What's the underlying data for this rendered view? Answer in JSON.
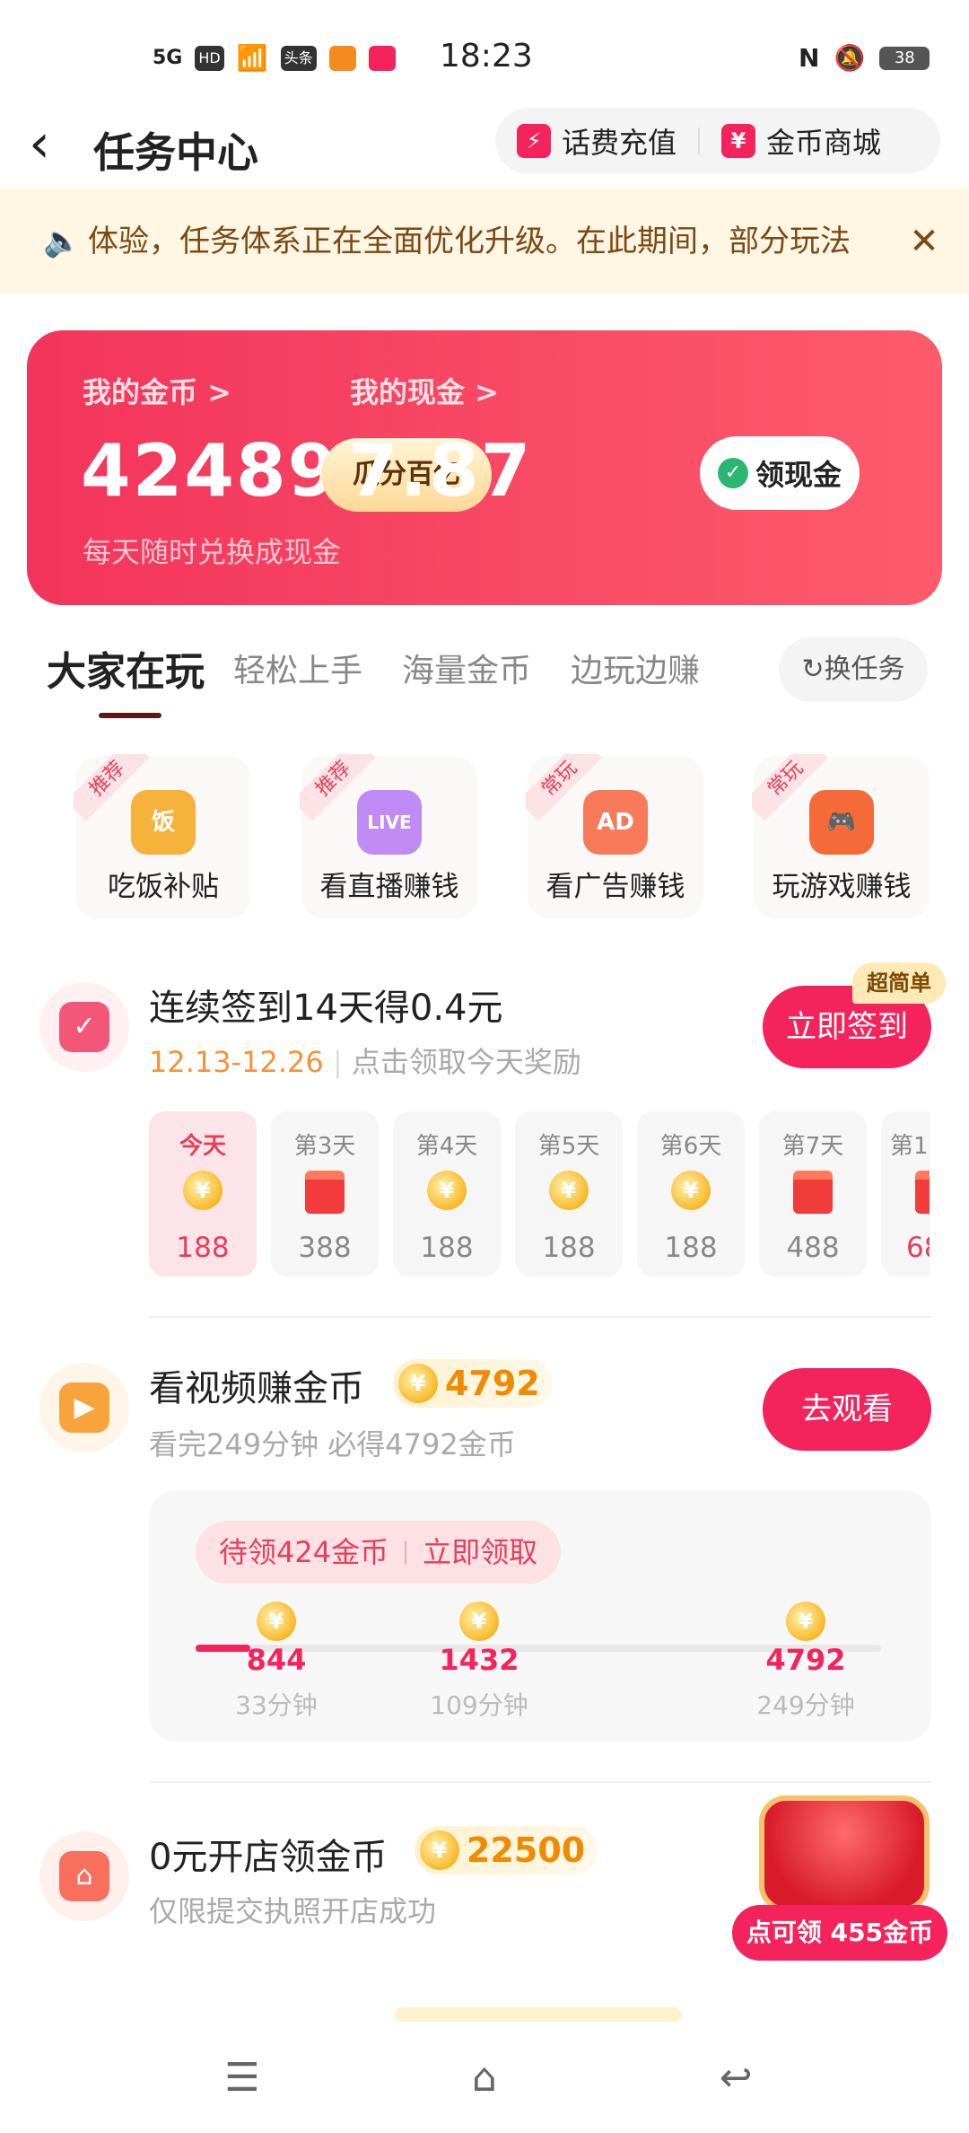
{
  "status": {
    "time": "18:23",
    "battery": "38",
    "network": "5G",
    "hd": "HD",
    "news_label": "头条"
  },
  "header": {
    "title": "任务中心",
    "recharge": "话费充值",
    "mall": "金币商城"
  },
  "notice": {
    "text": "体验，任务体系正在全面优化升级。在此期间，部分玩法"
  },
  "wallet": {
    "coins_label": "我的金币 >",
    "coins_value": "42489",
    "coins_button": "瓜分百亿",
    "cash_label": "我的现金 >",
    "cash_value": "7.87",
    "cash_button": "领现金",
    "sub": "每天随时兑换成现金"
  },
  "tabs": {
    "items": [
      "大家在玩",
      "轻松上手",
      "海量金币",
      "边玩边赚"
    ],
    "swap": "换任务"
  },
  "categories": [
    {
      "tag": "推荐",
      "name": "吃饭补贴",
      "icon_text": "饭"
    },
    {
      "tag": "推荐",
      "name": "看直播赚钱",
      "icon_text": "LIVE"
    },
    {
      "tag": "常玩",
      "name": "看广告赚钱",
      "icon_text": "AD"
    },
    {
      "tag": "常玩",
      "name": "玩游戏赚钱",
      "icon_text": "🎮"
    }
  ],
  "signin": {
    "title": "连续签到14天得0.4元",
    "dates": "12.13-12.26",
    "sub": "点击领取今天奖励",
    "button": "立即签到",
    "badge": "超简单",
    "days": [
      {
        "label": "今天",
        "value": "188",
        "kind": "coin"
      },
      {
        "label": "第3天",
        "value": "388",
        "kind": "gift"
      },
      {
        "label": "第4天",
        "value": "188",
        "kind": "coin"
      },
      {
        "label": "第5天",
        "value": "188",
        "kind": "coin"
      },
      {
        "label": "第6天",
        "value": "188",
        "kind": "coin"
      },
      {
        "label": "第7天",
        "value": "488",
        "kind": "gift"
      },
      {
        "label": "第1",
        "value": "68",
        "kind": "gift"
      }
    ]
  },
  "video": {
    "title": "看视频赚金币",
    "coins": "4792",
    "sub": "看完249分钟 必得4792金币",
    "button": "去观看",
    "pending": "待领424金币",
    "claim": "立即领取",
    "progress_fraction": 0.08,
    "milestones": [
      {
        "value": "844",
        "time": "33分钟"
      },
      {
        "value": "1432",
        "time": "109分钟"
      },
      {
        "value": "4792",
        "time": "249分钟"
      }
    ]
  },
  "shop": {
    "title": "0元开店领金币",
    "coins": "22500",
    "sub": "仅限提交执照开店成功",
    "chest_badge": "点可领 455金币"
  },
  "colors": {
    "accent": "#f4235c",
    "gold": "#f7b928",
    "notice_bg": "#fff6e3"
  }
}
